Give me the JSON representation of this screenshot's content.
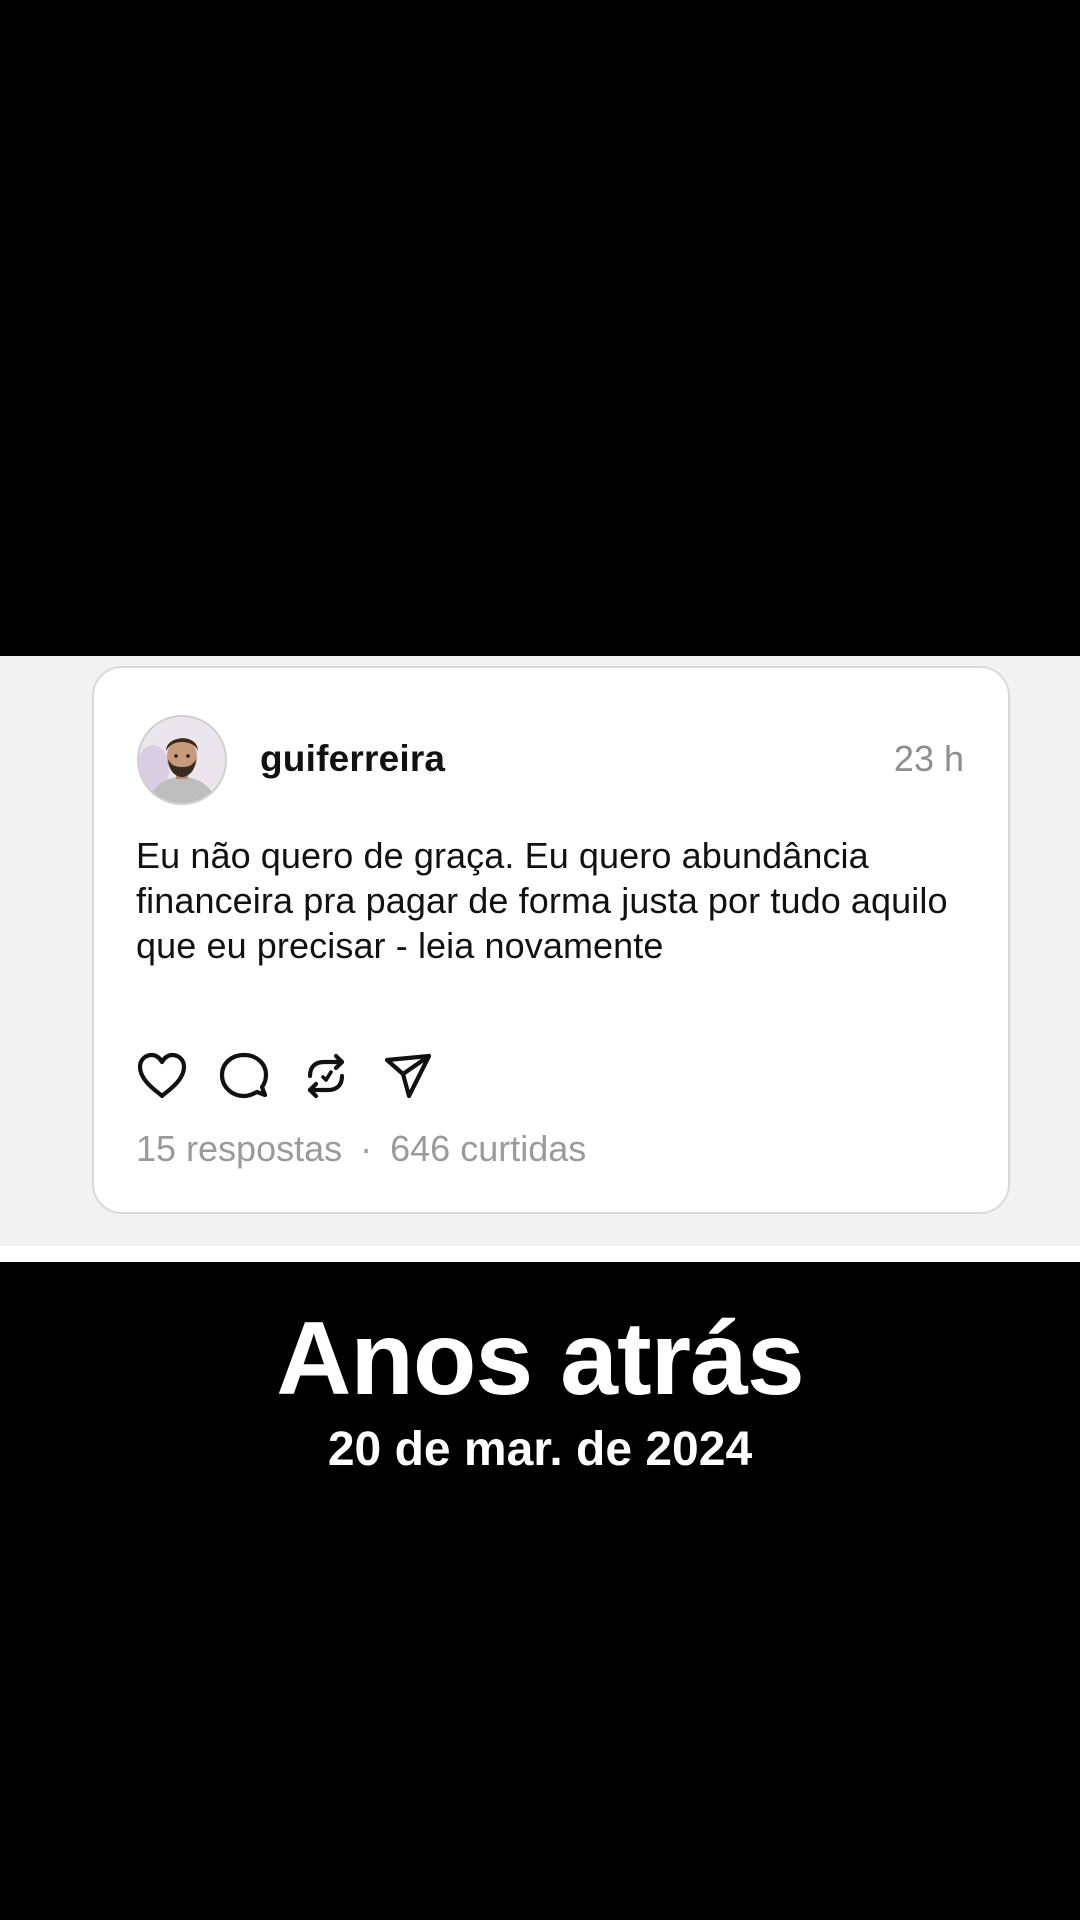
{
  "post": {
    "username": "guiferreira",
    "timestamp": "23 h",
    "text": "Eu não quero de graça. Eu quero abundância financeira pra pagar de forma justa por tudo aquilo que eu precisar - leia novamente",
    "replies": "15 respostas",
    "separator": "·",
    "likes": "646 curtidas",
    "actions": [
      "heart-icon",
      "comment-icon",
      "repost-icon",
      "share-icon"
    ]
  },
  "caption": {
    "title": "Anos atrás",
    "date": "20 de mar. de 2024"
  },
  "colors": {
    "background": "#000000",
    "band": "#f2f2f2",
    "card": "#ffffff",
    "text": "#111111",
    "muted": "#9a9a9a"
  }
}
